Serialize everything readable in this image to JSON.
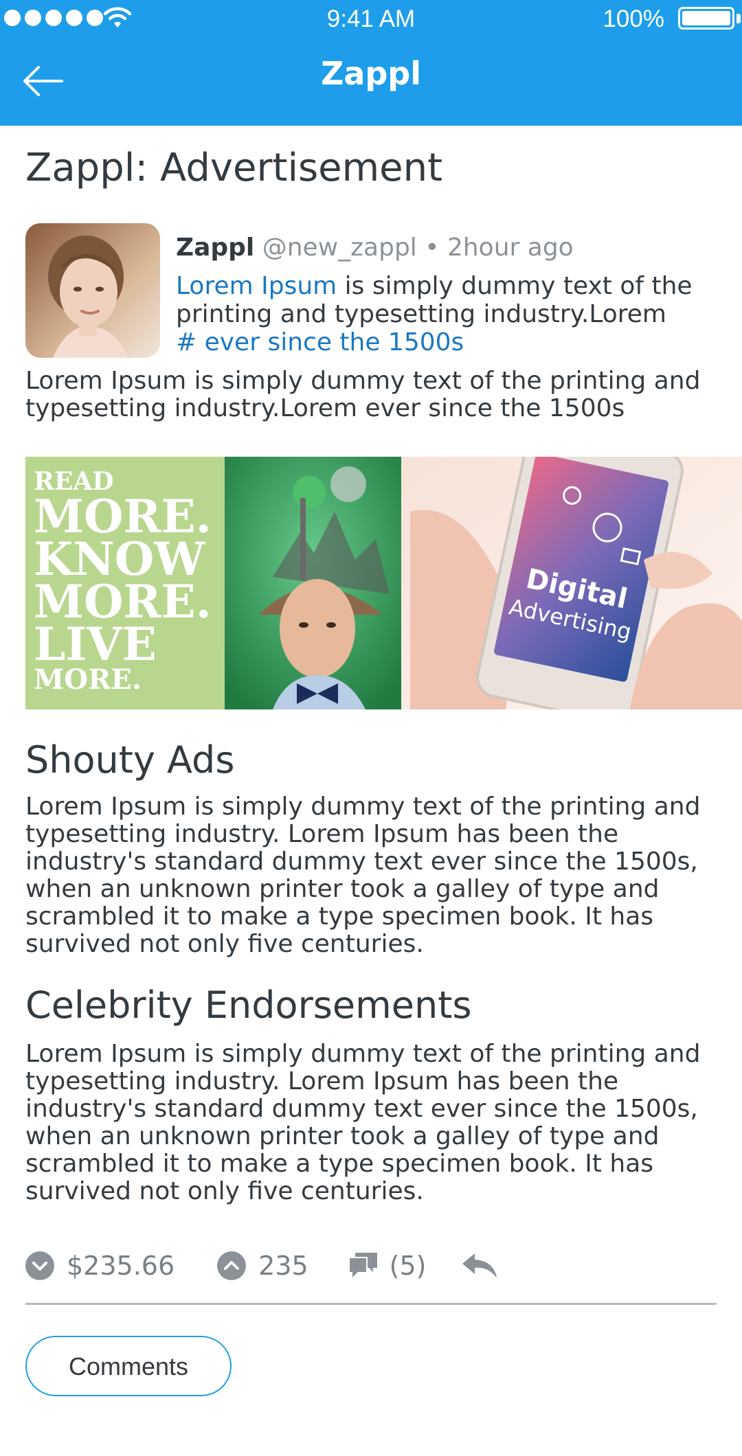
{
  "status_bar": {
    "time": "9:41 AM",
    "battery": "100%"
  },
  "header": {
    "title": "Zappl"
  },
  "page": {
    "title": "Zappl: Advertisement"
  },
  "post": {
    "author": "Zappl",
    "handle": "@new_zappl",
    "separator": "•",
    "time_ago": "2hour ago",
    "text_link": "Lorem Ipsum",
    "text_rest": " is simply dummy text of the printing and typesetting industry.Lorem",
    "hashtag": "# ever since the 1500s",
    "description": "Lorem Ipsum is simply dummy text of the printing and typesetting industry.Lorem ever since the 1500s"
  },
  "media": {
    "poster_lines": [
      "READ",
      "MORE.",
      "KNOW",
      "MORE.",
      "LIVE",
      "MORE."
    ],
    "phone_lines": [
      "Digital",
      "Advertising"
    ]
  },
  "sections": [
    {
      "title": "Shouty Ads",
      "body": "Lorem Ipsum is simply dummy text of the printing and typesetting industry. Lorem Ipsum has been the industry's standard dummy text ever since the 1500s, when an unknown printer took a galley of type and scrambled it to make a type specimen book. It has survived not only five centuries."
    },
    {
      "title": "Celebrity Endorsements",
      "body": "Lorem Ipsum is simply dummy text of the printing and typesetting industry. Lorem Ipsum has been the industry's standard dummy text ever since the 1500s, when an unknown printer took a galley of type and scrambled it to make a type specimen book. It has survived not only five centuries."
    }
  ],
  "actions": {
    "value": "$235.66",
    "upvotes": "235",
    "comments_count": "(5)"
  },
  "buttons": {
    "comments": "Comments"
  },
  "colors": {
    "header": "#1e9eea",
    "link": "#1a78c2",
    "icon": "#8b9196"
  }
}
